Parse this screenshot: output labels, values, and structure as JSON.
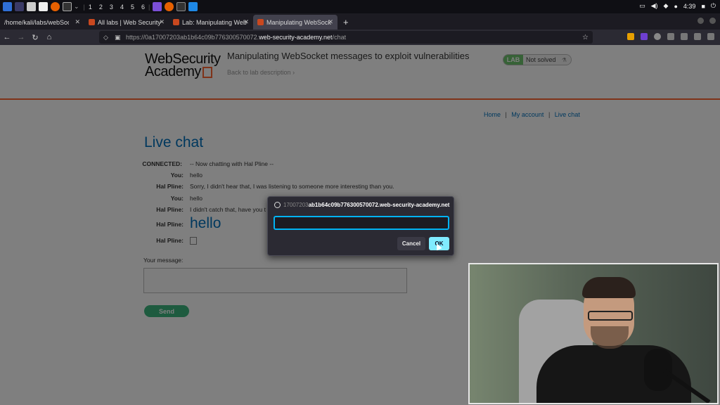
{
  "taskbar": {
    "workspaces": [
      "1",
      "2",
      "3",
      "4",
      "5",
      "6"
    ],
    "clock": "4:39"
  },
  "tabs": [
    {
      "label": "/home/kali/labs/webSockets",
      "active": false
    },
    {
      "label": "All labs | Web Security Ac",
      "active": false
    },
    {
      "label": "Lab: Manipulating WebSoc",
      "active": false
    },
    {
      "label": "Manipulating WebSocket",
      "active": true
    }
  ],
  "address": {
    "prefix": "https://0a17007203ab1b64c09b776300570072.",
    "host": "web-security-academy.net",
    "path": "/chat"
  },
  "header": {
    "logo_line1": "WebSecurity",
    "logo_line2": "Academy",
    "title": "Manipulating WebSocket messages to exploit vulnerabilities",
    "back_link": "Back to lab description",
    "lab_badge": "LAB",
    "lab_status": "Not solved"
  },
  "nav": {
    "home": "Home",
    "my_account": "My account",
    "live_chat": "Live chat"
  },
  "page_title": "Live chat",
  "chat": [
    {
      "who": "CONNECTED:",
      "msg": "-- Now chatting with Hal Pline --"
    },
    {
      "who": "You:",
      "msg": "hello"
    },
    {
      "who": "Hal Pline:",
      "msg": "Sorry, I didn't hear that, I was listening to someone more interesting than you."
    },
    {
      "who": "You:",
      "msg": "hello"
    },
    {
      "who": "Hal Pline:",
      "msg": "I didn't catch that, have you t"
    },
    {
      "who": "Hal Pline:",
      "msg": "hello"
    },
    {
      "who": "Hal Pline:",
      "msg": ""
    }
  ],
  "form": {
    "message_label": "Your message:",
    "send_label": "Send"
  },
  "dialog": {
    "origin_dim": "17007203",
    "origin_bold": "ab1b64c09b776300570072.web-security-academy.net",
    "input_value": "",
    "cancel_label": "Cancel",
    "ok_label": "OK"
  },
  "colors": {
    "accent": "#0071bc",
    "brand_orange": "#ff6633",
    "send_green": "#3cb67e",
    "ok_button": "#80ebff"
  }
}
